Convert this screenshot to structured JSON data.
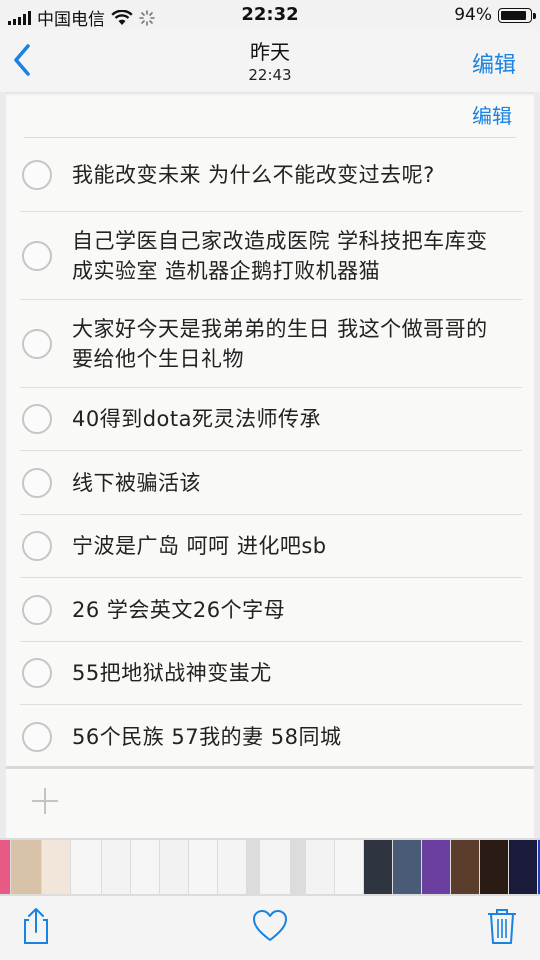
{
  "status_bar": {
    "carrier": "中国电信",
    "time": "22:32",
    "battery": "94%",
    "battery_level": 0.94
  },
  "nav": {
    "title": "昨天",
    "subtitle": "22:43",
    "edit_label": "编辑",
    "back_icon": "chevron-left-icon"
  },
  "note": {
    "edit_label": "编辑",
    "items": [
      {
        "text": "我能改变未来 为什么不能改变过去呢?",
        "done": false
      },
      {
        "text": "自己学医自己家改造成医院 学科技把车库变成实验室 造机器企鹅打败机器猫",
        "done": false
      },
      {
        "text": "大家好今天是我弟弟的生日 我这个做哥哥的要给他个生日礼物",
        "done": false
      },
      {
        "text": "40得到dota死灵法师传承",
        "done": false
      },
      {
        "text": "线下被骗活该",
        "done": false
      },
      {
        "text": "宁波是广岛 呵呵 进化吧sb",
        "done": false
      },
      {
        "text": "26 学会英文26个字母",
        "done": false
      },
      {
        "text": "55把地狱战神变蚩尤",
        "done": false
      },
      {
        "text": "56个民族 57我的妻 58同城",
        "done": false
      }
    ]
  },
  "toolbar": {
    "share_icon": "share-icon",
    "like_icon": "heart-icon",
    "delete_icon": "trash-icon"
  },
  "colors": {
    "accent": "#1a82e0",
    "paper": "#f9f9f7",
    "circle_border": "#c6c6c6"
  }
}
